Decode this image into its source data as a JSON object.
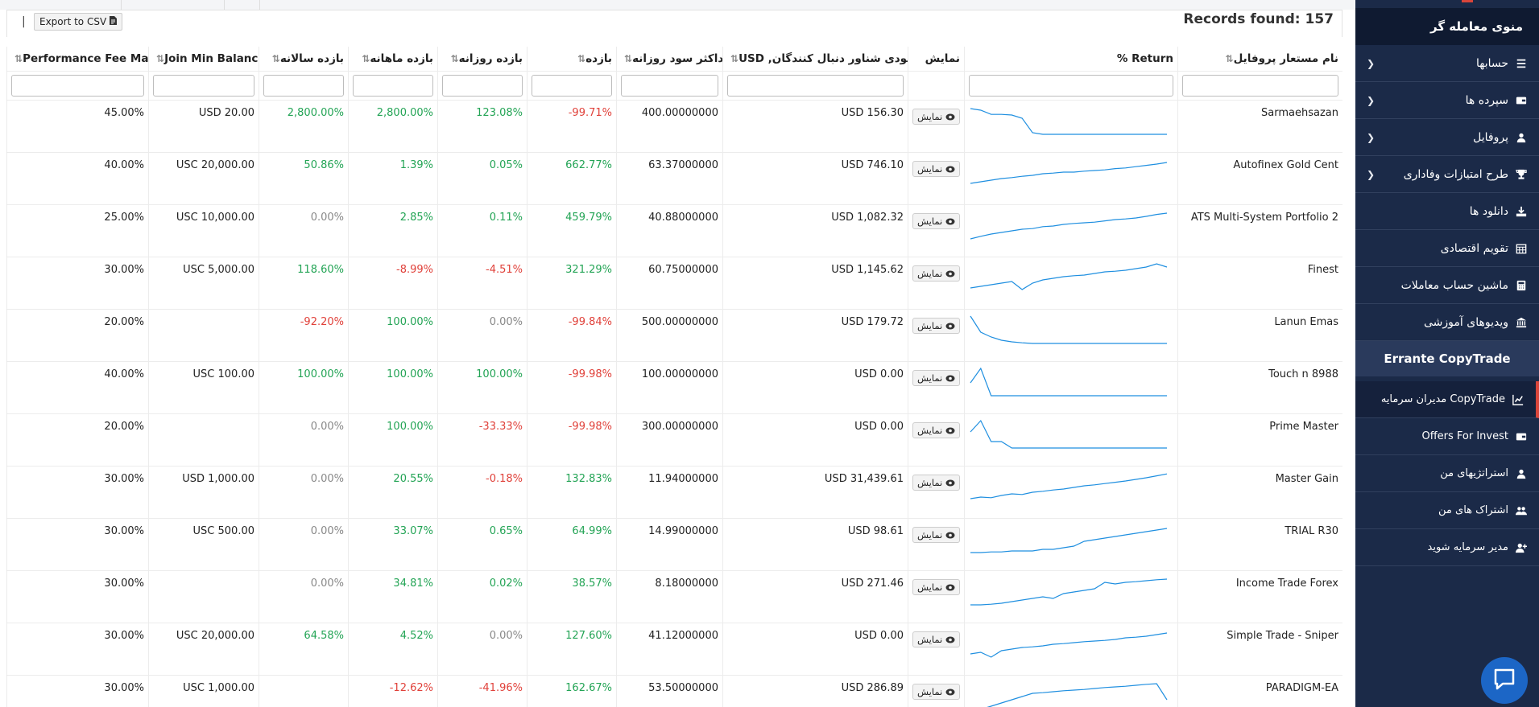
{
  "sidebar": {
    "header": "منوی معامله گر",
    "items": [
      {
        "label": "حسابها",
        "icon": "list-icon",
        "chevron": true
      },
      {
        "label": "سپرده ها",
        "icon": "wallet-icon",
        "chevron": true
      },
      {
        "label": "پروفایل",
        "icon": "user-icon",
        "chevron": true
      },
      {
        "label": "طرح امتیازات وفاداری",
        "icon": "trophy-icon",
        "chevron": true
      },
      {
        "label": "دانلود ها",
        "icon": "download-icon",
        "chevron": false
      },
      {
        "label": "تقویم اقتصادی",
        "icon": "calendar-icon",
        "chevron": false
      },
      {
        "label": "ماشین حساب معاملات",
        "icon": "calculator-icon",
        "chevron": false
      },
      {
        "label": "ویدیوهای آموزشی",
        "icon": "bank-icon",
        "chevron": false
      }
    ],
    "section_title": "Errante CopyTrade",
    "copytrade_items": [
      {
        "label": "CopyTrade مدیران سرمایه",
        "icon": "chart-line-icon",
        "active": true
      },
      {
        "label": "Offers For Invest",
        "icon": "wallet-icon",
        "active": false
      },
      {
        "label": "استراتژیهای من",
        "icon": "user-icon",
        "active": false
      },
      {
        "label": "اشتراک های من",
        "icon": "users-icon",
        "active": false
      },
      {
        "label": "مدیر سرمایه شوید",
        "icon": "user-plus-icon",
        "active": false
      }
    ]
  },
  "toolbar": {
    "pipe": "|",
    "export_label": "Export to CSV",
    "export_icon": "file-icon",
    "records_found": "Records found: 157"
  },
  "table": {
    "headers": {
      "name": "نام مستعار پروفایل",
      "return": "Return %",
      "view": "نمایش",
      "equity": "موجودی شناور دنبال کنندگان, USD",
      "max_daily": "حداکثر سود روزانه",
      "period": "بازده",
      "daily": "بازده روزانه",
      "monthly": "بازده ماهانه",
      "yearly": "بازده سالانه",
      "join_min": "Join Min Balance",
      "fee_max": "Performance Fee Max"
    },
    "view_button_label": "نمایش",
    "rows": [
      {
        "name": "Sarmaehsazan",
        "equity": "USD 156.30",
        "max_daily": "400.00000000",
        "period": "-99.71%",
        "period_c": "neg",
        "daily": "123.08%",
        "daily_c": "pos",
        "monthly": "2,800.00%",
        "monthly_c": "pos",
        "yearly": "2,800.00%",
        "yearly_c": "pos",
        "join_min": "USD 20.00",
        "fee_max": "45.00%",
        "spark": [
          0.9,
          0.85,
          0.72,
          0.72,
          0.7,
          0.6,
          0.15,
          0.1,
          0.1,
          0.1,
          0.1,
          0.1,
          0.1,
          0.1,
          0.1,
          0.1,
          0.1,
          0.1,
          0.1,
          0.1
        ]
      },
      {
        "name": "Autofinex Gold Cent",
        "equity": "USD 746.10",
        "max_daily": "63.37000000",
        "period": "662.77%",
        "period_c": "pos",
        "daily": "0.05%",
        "daily_c": "pos",
        "monthly": "1.39%",
        "monthly_c": "pos",
        "yearly": "50.86%",
        "yearly_c": "pos",
        "join_min": "USC 20,000.00",
        "fee_max": "40.00%",
        "spark": [
          0.2,
          0.25,
          0.3,
          0.35,
          0.38,
          0.42,
          0.45,
          0.5,
          0.52,
          0.55,
          0.55,
          0.58,
          0.6,
          0.62,
          0.66,
          0.68,
          0.72,
          0.76,
          0.8,
          0.85
        ]
      },
      {
        "name": "ATS Multi-System Portfolio 2",
        "equity": "USD 1,082.32",
        "max_daily": "40.88000000",
        "period": "459.79%",
        "period_c": "pos",
        "daily": "0.11%",
        "daily_c": "pos",
        "monthly": "2.85%",
        "monthly_c": "pos",
        "yearly": "0.00%",
        "yearly_c": "zero",
        "join_min": "USC 10,000.00",
        "fee_max": "25.00%",
        "spark": [
          0.1,
          0.18,
          0.25,
          0.3,
          0.35,
          0.4,
          0.42,
          0.48,
          0.5,
          0.55,
          0.58,
          0.6,
          0.62,
          0.66,
          0.7,
          0.72,
          0.75,
          0.8,
          0.86,
          0.9
        ]
      },
      {
        "name": "Finest",
        "equity": "USD 1,145.62",
        "max_daily": "60.75000000",
        "period": "321.29%",
        "period_c": "pos",
        "daily": "-4.51%",
        "daily_c": "neg",
        "monthly": "-8.99%",
        "monthly_c": "neg",
        "yearly": "118.60%",
        "yearly_c": "pos",
        "join_min": "USC 5,000.00",
        "fee_max": "30.00%",
        "spark": [
          0.2,
          0.25,
          0.3,
          0.35,
          0.4,
          0.15,
          0.35,
          0.45,
          0.5,
          0.55,
          0.58,
          0.6,
          0.65,
          0.7,
          0.72,
          0.75,
          0.8,
          0.85,
          0.95,
          0.85
        ]
      },
      {
        "name": "Lanun Emas",
        "equity": "USD 179.72",
        "max_daily": "500.00000000",
        "period": "-99.84%",
        "period_c": "neg",
        "daily": "0.00%",
        "daily_c": "zero",
        "monthly": "100.00%",
        "monthly_c": "pos",
        "yearly": "-92.20%",
        "yearly_c": "neg",
        "join_min": "",
        "fee_max": "20.00%",
        "spark": [
          0.95,
          0.45,
          0.3,
          0.2,
          0.15,
          0.12,
          0.1,
          0.1,
          0.1,
          0.1,
          0.1,
          0.1,
          0.1,
          0.1,
          0.1,
          0.1,
          0.1,
          0.1,
          0.1,
          0.1
        ]
      },
      {
        "name": "Touch n 8988",
        "equity": "USD 0.00",
        "max_daily": "100.00000000",
        "period": "-99.98%",
        "period_c": "neg",
        "daily": "100.00%",
        "daily_c": "pos",
        "monthly": "100.00%",
        "monthly_c": "pos",
        "yearly": "100.00%",
        "yearly_c": "pos",
        "join_min": "USC 100.00",
        "fee_max": "40.00%",
        "spark": [
          0.5,
          0.95,
          0.1,
          0.1,
          0.1,
          0.1,
          0.1,
          0.1,
          0.1,
          0.1,
          0.1,
          0.1,
          0.1,
          0.1,
          0.1,
          0.1,
          0.1,
          0.1,
          0.1,
          0.1
        ]
      },
      {
        "name": "Prime Master",
        "equity": "USD 0.00",
        "max_daily": "300.00000000",
        "period": "-99.98%",
        "period_c": "neg",
        "daily": "-33.33%",
        "daily_c": "neg",
        "monthly": "100.00%",
        "monthly_c": "pos",
        "yearly": "0.00%",
        "yearly_c": "zero",
        "join_min": "",
        "fee_max": "20.00%",
        "spark": [
          0.6,
          0.95,
          0.3,
          0.3,
          0.1,
          0.1,
          0.1,
          0.1,
          0.1,
          0.1,
          0.1,
          0.1,
          0.1,
          0.1,
          0.1,
          0.1,
          0.1,
          0.1,
          0.1,
          0.1
        ]
      },
      {
        "name": "Master Gain",
        "equity": "USD 31,439.61",
        "max_daily": "11.94000000",
        "period": "132.83%",
        "period_c": "pos",
        "daily": "-0.18%",
        "daily_c": "neg",
        "monthly": "20.55%",
        "monthly_c": "pos",
        "yearly": "0.00%",
        "yearly_c": "zero",
        "join_min": "USD 1,000.00",
        "fee_max": "30.00%",
        "spark": [
          0.15,
          0.2,
          0.18,
          0.25,
          0.3,
          0.28,
          0.35,
          0.38,
          0.42,
          0.45,
          0.5,
          0.55,
          0.58,
          0.62,
          0.66,
          0.7,
          0.75,
          0.8,
          0.86,
          0.92
        ]
      },
      {
        "name": "TRIAL R30",
        "equity": "USD 98.61",
        "max_daily": "14.99000000",
        "period": "64.99%",
        "period_c": "pos",
        "daily": "0.65%",
        "daily_c": "pos",
        "monthly": "33.07%",
        "monthly_c": "pos",
        "yearly": "0.00%",
        "yearly_c": "zero",
        "join_min": "USC 500.00",
        "fee_max": "30.00%",
        "spark": [
          0.1,
          0.1,
          0.12,
          0.12,
          0.15,
          0.15,
          0.15,
          0.2,
          0.2,
          0.25,
          0.3,
          0.45,
          0.5,
          0.55,
          0.6,
          0.65,
          0.7,
          0.75,
          0.8,
          0.85
        ]
      },
      {
        "name": "Income Trade Forex",
        "equity": "USD 271.46",
        "max_daily": "8.18000000",
        "period": "38.57%",
        "period_c": "pos",
        "daily": "0.02%",
        "daily_c": "pos",
        "monthly": "34.81%",
        "monthly_c": "pos",
        "yearly": "0.00%",
        "yearly_c": "zero",
        "join_min": "",
        "fee_max": "30.00%",
        "spark": [
          0.1,
          0.1,
          0.12,
          0.15,
          0.2,
          0.25,
          0.3,
          0.35,
          0.3,
          0.45,
          0.5,
          0.55,
          0.6,
          0.8,
          0.75,
          0.8,
          0.82,
          0.85,
          0.88,
          0.9
        ]
      },
      {
        "name": "Simple Trade - Sniper",
        "equity": "USD 0.00",
        "max_daily": "41.12000000",
        "period": "127.60%",
        "period_c": "pos",
        "daily": "0.00%",
        "daily_c": "zero",
        "monthly": "4.52%",
        "monthly_c": "pos",
        "yearly": "64.58%",
        "yearly_c": "pos",
        "join_min": "USC 20,000.00",
        "fee_max": "30.00%",
        "spark": [
          0.2,
          0.25,
          0.1,
          0.3,
          0.35,
          0.4,
          0.42,
          0.45,
          0.5,
          0.52,
          0.55,
          0.58,
          0.6,
          0.62,
          0.65,
          0.7,
          0.72,
          0.75,
          0.8,
          0.85
        ]
      },
      {
        "name": "PARADIGM-EA",
        "equity": "USD 286.89",
        "max_daily": "53.50000000",
        "period": "162.67%",
        "period_c": "pos",
        "daily": "-41.96%",
        "daily_c": "neg",
        "monthly": "-12.62%",
        "monthly_c": "neg",
        "yearly": "",
        "yearly_c": "zero",
        "join_min": "USC 1,000.00",
        "fee_max": "30.00%",
        "spark": [
          0.05,
          0.1,
          0.2,
          0.3,
          0.4,
          0.5,
          0.6,
          0.62,
          0.65,
          0.68,
          0.7,
          0.72,
          0.75,
          0.78,
          0.8,
          0.82,
          0.85,
          0.88,
          0.9,
          0.4
        ]
      }
    ]
  },
  "colors": {
    "sidebar_bg": "#1b2a48",
    "positive": "#23a455",
    "negative": "#e0413a",
    "spark": "#1f8fe0",
    "accent": "#d9453a"
  }
}
